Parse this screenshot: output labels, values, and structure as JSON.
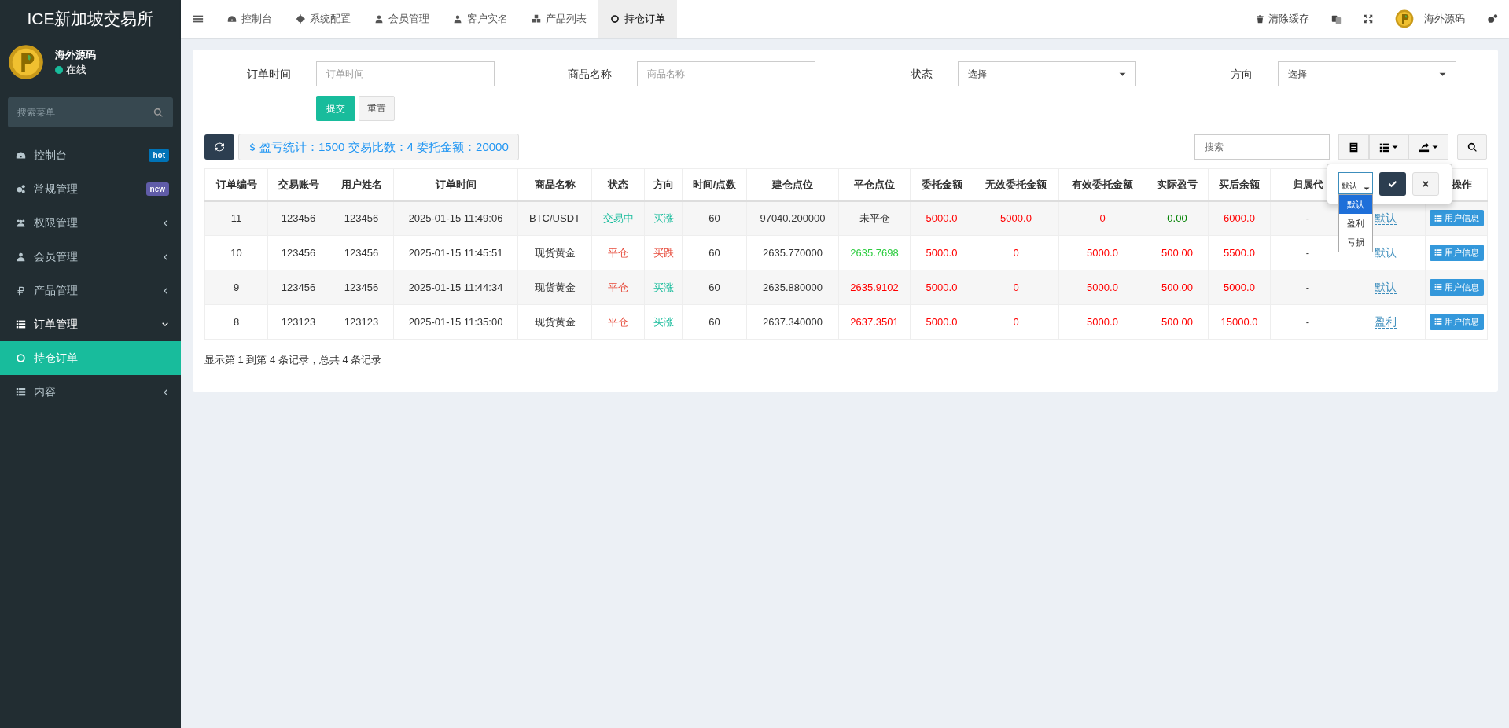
{
  "sidebar": {
    "brand": "ICE新加坡交易所",
    "user": {
      "name": "海外源码",
      "status": "在线"
    },
    "search": {
      "placeholder": "搜索菜单"
    },
    "items": [
      {
        "label": "控制台",
        "badge": {
          "text": "hot",
          "color": "#0073b7"
        },
        "selected": false
      },
      {
        "label": "常规管理",
        "badge": {
          "text": "new",
          "color": "#605ca8"
        },
        "selected": false
      },
      {
        "label": "权限管理",
        "expanded": false,
        "selected": false
      },
      {
        "label": "会员管理",
        "expanded": false,
        "selected": false
      },
      {
        "label": "产品管理",
        "expanded": false,
        "selected": false
      },
      {
        "label": "订单管理",
        "expanded": true,
        "selected": false,
        "children": [
          {
            "label": "持仓订单",
            "selected": true
          }
        ]
      },
      {
        "label": "内容",
        "expanded": false,
        "selected": false
      }
    ]
  },
  "topbar": {
    "tabs": [
      {
        "label": "控制台",
        "selected": false
      },
      {
        "label": "系统配置",
        "selected": false
      },
      {
        "label": "会员管理",
        "selected": false
      },
      {
        "label": "客户实名",
        "selected": false
      },
      {
        "label": "产品列表",
        "selected": false
      },
      {
        "label": "持仓订单",
        "selected": true
      }
    ],
    "clear_cache": "清除缓存",
    "username": "海外源码"
  },
  "filters": [
    {
      "label": "订单时间",
      "kind": "input",
      "placeholder": "订单时间"
    },
    {
      "label": "商品名称",
      "kind": "input",
      "placeholder": "商品名称"
    },
    {
      "label": "状态",
      "kind": "select",
      "value": "选择"
    },
    {
      "label": "方向",
      "kind": "select",
      "value": "选择"
    }
  ],
  "form_buttons": [
    "提交",
    "重置"
  ],
  "summary": "盈亏统计：1500 交易比数：4 委托金额：20000",
  "table_search": {
    "placeholder": "搜索"
  },
  "table": {
    "columns": [
      "订单编号",
      "交易账号",
      "用户姓名",
      "订单时间",
      "商品名称",
      "状态",
      "方向",
      "时间/点数",
      "建仓点位",
      "平仓点位",
      "委托金额",
      "无效委托金额",
      "有效委托金额",
      "实际盈亏",
      "买后余额",
      "归属代",
      null,
      "操作"
    ],
    "rows": [
      {
        "cells": [
          {
            "text": "11"
          },
          {
            "text": "123456"
          },
          {
            "text": "123456"
          },
          {
            "text": "2025-01-15 11:49:06"
          },
          {
            "text": "BTC/USDT"
          },
          {
            "text": "交易中",
            "color": "#18bc9c"
          },
          {
            "text": "买涨",
            "color": "#18bc9c"
          },
          {
            "text": "60"
          },
          {
            "text": "97040.200000"
          },
          {
            "text": "未平仓"
          },
          {
            "text": "5000.0",
            "color": "#ff0000"
          },
          {
            "text": "5000.0",
            "color": "#ff0000"
          },
          {
            "text": "0",
            "color": "#ff0000"
          },
          {
            "text": "0.00",
            "color": "#008000"
          },
          {
            "text": "6000.0",
            "color": "#ff0000"
          },
          {
            "text": "-"
          },
          {
            "text": "默认",
            "kind": "link"
          },
          {
            "text": "用户信息",
            "kind": "button"
          }
        ]
      },
      {
        "cells": [
          {
            "text": "10"
          },
          {
            "text": "123456"
          },
          {
            "text": "123456"
          },
          {
            "text": "2025-01-15 11:45:51"
          },
          {
            "text": "现货黄金"
          },
          {
            "text": "平仓",
            "color": "#e74c3c"
          },
          {
            "text": "买跌",
            "color": "#e74c3c"
          },
          {
            "text": "60"
          },
          {
            "text": "2635.770000"
          },
          {
            "text": "2635.7698",
            "color": "#2ecc40"
          },
          {
            "text": "5000.0",
            "color": "#ff0000"
          },
          {
            "text": "0",
            "color": "#ff0000"
          },
          {
            "text": "5000.0",
            "color": "#ff0000"
          },
          {
            "text": "500.00",
            "color": "#ff0000"
          },
          {
            "text": "5500.0",
            "color": "#ff0000"
          },
          {
            "text": "-"
          },
          {
            "text": "默认",
            "kind": "link"
          },
          {
            "text": "用户信息",
            "kind": "button"
          }
        ]
      },
      {
        "cells": [
          {
            "text": "9"
          },
          {
            "text": "123456"
          },
          {
            "text": "123456"
          },
          {
            "text": "2025-01-15 11:44:34"
          },
          {
            "text": "现货黄金"
          },
          {
            "text": "平仓",
            "color": "#e74c3c"
          },
          {
            "text": "买涨",
            "color": "#18bc9c"
          },
          {
            "text": "60"
          },
          {
            "text": "2635.880000"
          },
          {
            "text": "2635.9102",
            "color": "#ff0000"
          },
          {
            "text": "5000.0",
            "color": "#ff0000"
          },
          {
            "text": "0",
            "color": "#ff0000"
          },
          {
            "text": "5000.0",
            "color": "#ff0000"
          },
          {
            "text": "500.00",
            "color": "#ff0000"
          },
          {
            "text": "5000.0",
            "color": "#ff0000"
          },
          {
            "text": "-"
          },
          {
            "text": "默认",
            "kind": "link"
          },
          {
            "text": "用户信息",
            "kind": "button"
          }
        ]
      },
      {
        "cells": [
          {
            "text": "8"
          },
          {
            "text": "123123"
          },
          {
            "text": "123123"
          },
          {
            "text": "2025-01-15 11:35:00"
          },
          {
            "text": "现货黄金"
          },
          {
            "text": "平仓",
            "color": "#e74c3c"
          },
          {
            "text": "买涨",
            "color": "#18bc9c"
          },
          {
            "text": "60"
          },
          {
            "text": "2637.340000"
          },
          {
            "text": "2637.3501",
            "color": "#ff0000"
          },
          {
            "text": "5000.0",
            "color": "#ff0000"
          },
          {
            "text": "0",
            "color": "#ff0000"
          },
          {
            "text": "5000.0",
            "color": "#ff0000"
          },
          {
            "text": "500.00",
            "color": "#ff0000"
          },
          {
            "text": "15000.0",
            "color": "#ff0000"
          },
          {
            "text": "-"
          },
          {
            "text": "盈利",
            "kind": "link"
          },
          {
            "text": "用户信息",
            "kind": "button"
          }
        ]
      }
    ]
  },
  "popover": {
    "value": "默认",
    "options": [
      {
        "text": "默认",
        "selected": true
      },
      {
        "text": "盈利",
        "selected": false
      },
      {
        "text": "亏损",
        "selected": false
      }
    ]
  },
  "pagination_info": "显示第 1 到第 4 条记录，总共 4 条记录"
}
